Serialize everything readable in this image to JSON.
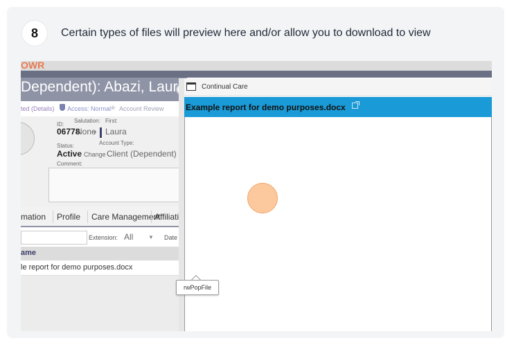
{
  "step": {
    "number": "8",
    "instruction": "Certain types of files will preview here and/or allow you to download to view"
  },
  "app": {
    "brand_fragment": "OWR",
    "client_title": "Dependent): Abazi, Laura",
    "status_links": [
      "ted (Details)",
      "Access: Normal",
      "Account Review"
    ],
    "fields": {
      "id_label": "ID:",
      "id_value": "06778",
      "salutation_label": "Salutation:",
      "salutation_value": "None",
      "first_label": "First:",
      "first_value": "Laura",
      "status_label": "Status:",
      "status_value": "Active",
      "change_label": "Change",
      "account_type_label": "Account Type:",
      "account_type_value": "Client (Dependent)",
      "comment_label": "Comment:"
    },
    "tabs": [
      "mation",
      "Profile",
      "Care Management",
      "Affiliation"
    ],
    "filter": {
      "extension_label": "Extension:",
      "extension_value": "All",
      "date_label": "Date"
    },
    "grid": {
      "header": "ame",
      "rows": [
        "le report for demo purposes.docx"
      ]
    },
    "tooltip": "rwPopFile"
  },
  "popup": {
    "window_title": "Continual Care",
    "file_title": "Example report for demo purposes.docx",
    "header_color": "#1a9ad6"
  },
  "colors": {
    "accent": "#1a9ad6",
    "client_bar": "#8f93a6",
    "cursor_highlight": "#fbbf8d"
  }
}
